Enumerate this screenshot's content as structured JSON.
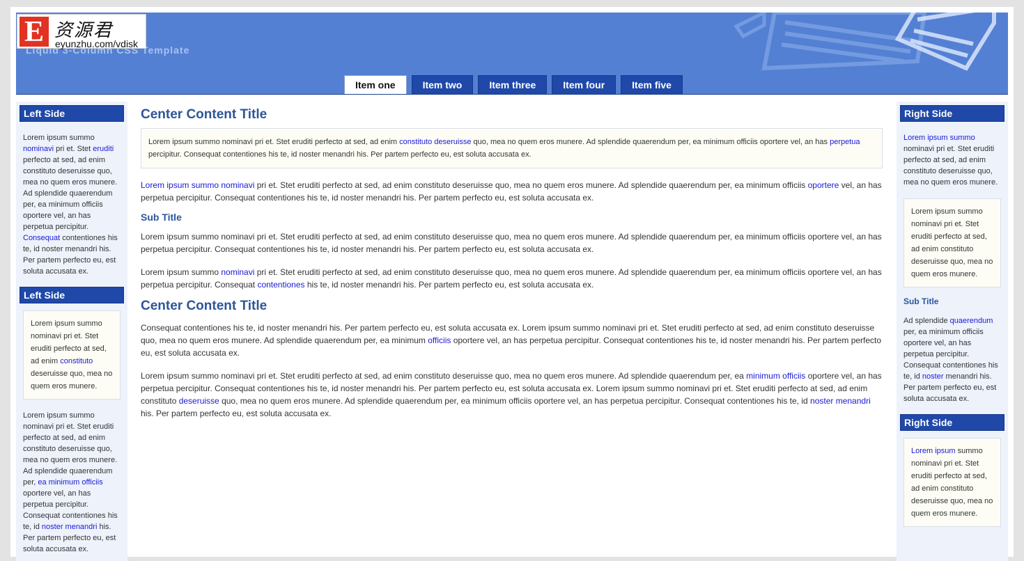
{
  "header": {
    "logo_letter": "E",
    "logo_cn": "资源君",
    "logo_url": "eyunzhu.com/vdisk",
    "tagline": "Liquid 3-Column CSS Template",
    "tabs": [
      {
        "label": "Item one",
        "active": true
      },
      {
        "label": "Item two",
        "active": false
      },
      {
        "label": "Item three",
        "active": false
      },
      {
        "label": "Item four",
        "active": false
      },
      {
        "label": "Item five",
        "active": false
      }
    ]
  },
  "left": {
    "heading1": "Left Side",
    "p1": {
      "a": "Lorem ipsum summo ",
      "l1": "nominavi",
      "b": " pri et. Stet ",
      "l2": "eruditi",
      "c": " perfecto at sed, ad enim constituto deseruisse quo, mea no quem eros munere. Ad splendide quaerendum per, ea minimum officiis oportere vel, an has perpetua percipitur. ",
      "l3": "Consequat",
      "d": " contentiones his te, id noster menandri his. Per partem perfecto eu, est soluta accusata ex."
    },
    "heading2": "Left Side",
    "box": {
      "a": "Lorem ipsum summo nominavi pri et. Stet eruditi perfecto at sed, ad enim ",
      "l1": "constituto",
      "b": " deseruisse quo, mea no quem eros munere."
    },
    "p2": {
      "a": "Lorem ipsum summo nominavi pri et. Stet eruditi perfecto at sed, ad enim constituto deseruisse quo, mea no quem eros munere. Ad splendide quaerendum per, ",
      "l1": "ea minimum officiis",
      "b": " oportere vel, an has perpetua percipitur. Consequat contentiones his te, id ",
      "l2": "noster menandri",
      "c": " his. Per partem perfecto eu, est soluta accusata ex."
    }
  },
  "center": {
    "title1": "Center Content Title",
    "box": {
      "a": "Lorem ipsum summo nominavi pri et. Stet eruditi perfecto at sed, ad enim ",
      "l1": "constituto deseruisse",
      "b": " quo, mea no quem eros munere. Ad splendide quaerendum per, ea minimum officiis oportere vel, an has ",
      "l2": "perpetua",
      "c": " percipitur. Consequat contentiones his te, id noster menandri his. Per partem perfecto eu, est soluta accusata ex."
    },
    "p1": {
      "l1": "Lorem ipsum summo nominavi",
      "a": " pri et. Stet eruditi perfecto at sed, ad enim constituto deseruisse quo, mea no quem eros munere. Ad splendide quaerendum per, ea minimum officiis ",
      "l2": "oportere",
      "b": " vel, an has perpetua percipitur. Consequat contentiones his te, id noster menandri his. Per partem perfecto eu, est soluta accusata ex."
    },
    "subtitle": "Sub Title",
    "p2": "Lorem ipsum summo nominavi pri et. Stet eruditi perfecto at sed, ad enim constituto deseruisse quo, mea no quem eros munere. Ad splendide quaerendum per, ea minimum officiis oportere vel, an has perpetua percipitur. Consequat contentiones his te, id noster menandri his. Per partem perfecto eu, est soluta accusata ex.",
    "p3": {
      "a": "Lorem ipsum summo ",
      "l1": "nominavi",
      "b": " pri et. Stet eruditi perfecto at sed, ad enim constituto deseruisse quo, mea no quem eros munere. Ad splendide quaerendum per, ea minimum officiis oportere vel, an has perpetua percipitur. Consequat ",
      "l2": "contentiones",
      "c": " his te, id noster menandri his. Per partem perfecto eu, est soluta accusata ex."
    },
    "title2": "Center Content Title",
    "p4": {
      "a": "Consequat contentiones his te, id noster menandri his. Per partem perfecto eu, est soluta accusata ex. Lorem ipsum summo nominavi pri et. Stet eruditi perfecto at sed, ad enim constituto deseruisse quo, mea no quem eros munere. Ad splendide quaerendum per, ea minimum ",
      "l1": "officiis",
      "b": " oportere vel, an has perpetua percipitur. Consequat contentiones his te, id noster menandri his. Per partem perfecto eu, est soluta accusata ex."
    },
    "p5": {
      "a": "Lorem ipsum summo nominavi pri et. Stet eruditi perfecto at sed, ad enim constituto deseruisse quo, mea no quem eros munere. Ad splendide quaerendum per, ea ",
      "l1": "minimum officiis",
      "b": " oportere vel, an has perpetua percipitur. Consequat contentiones his te, id noster menandri his. Per partem perfecto eu, est soluta accusata ex. Lorem ipsum summo nominavi pri et. Stet eruditi perfecto at sed, ad enim constituto ",
      "l2": "deseruisse",
      "c": " quo, mea no quem eros munere. Ad splendide quaerendum per, ea minimum officiis oportere vel, an has perpetua percipitur. Consequat contentiones his te, id ",
      "l3": "noster menandri",
      "d": " his. Per partem perfecto eu, est soluta accusata ex."
    }
  },
  "right": {
    "heading1": "Right Side",
    "p1": {
      "l1": "Lorem ipsum summo",
      "a": " nominavi pri et. Stet eruditi perfecto at sed, ad enim constituto deseruisse quo, mea no quem eros munere."
    },
    "box1": "Lorem ipsum summo nominavi pri et. Stet eruditi perfecto at sed, ad enim constituto deseruisse quo, mea no quem eros munere.",
    "subtitle": "Sub Title",
    "p2": {
      "a": "Ad splendide ",
      "l1": "quaerendum",
      "b": " per, ea minimum officiis oportere vel, an has perpetua percipitur. Consequat contentiones his te, id ",
      "l2": "noster",
      "c": " menandri his. Per partem perfecto eu, est soluta accusata ex."
    },
    "heading2": "Right Side",
    "box2": {
      "l1": "Lorem ipsum",
      "a": " summo nominavi pri et. Stet eruditi perfecto at sed, ad enim constituto deseruisse quo, mea no quem eros munere."
    }
  },
  "colors": {
    "header_bg": "#5380d3",
    "tab_bg": "#1f48a8",
    "title": "#2e5698",
    "link": "#1a1ad6"
  }
}
